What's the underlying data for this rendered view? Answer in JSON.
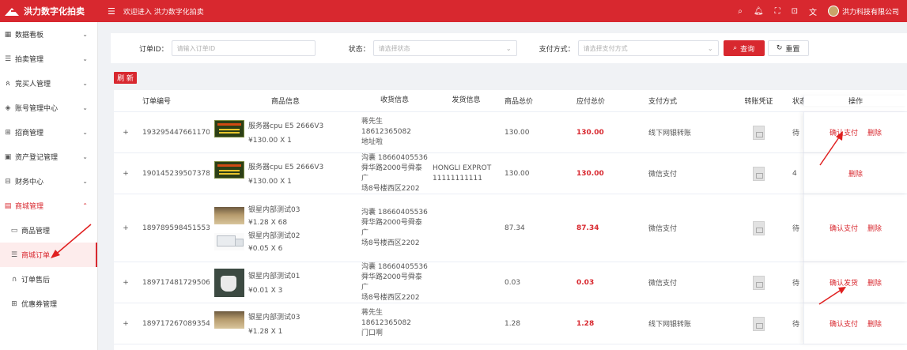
{
  "app": {
    "title": "洪力数字化拍卖",
    "welcome": "欢迎进入 洪力数字化拍卖",
    "company": "洪力科技有限公司",
    "brand_color": "#d8282f",
    "top_icons": [
      "search-icon",
      "bell-icon",
      "fullscreen-icon",
      "lock-icon",
      "translate-icon"
    ]
  },
  "sidebar": {
    "items": [
      {
        "label": "数据看板",
        "icon": "grid-icon"
      },
      {
        "label": "拍卖管理",
        "icon": "list-icon"
      },
      {
        "label": "竞买人管理",
        "icon": "people-icon"
      },
      {
        "label": "账号管理中心",
        "icon": "account-icon"
      },
      {
        "label": "招商管理",
        "icon": "plus-square-icon"
      },
      {
        "label": "资产登记管理",
        "icon": "register-icon"
      },
      {
        "label": "财务中心",
        "icon": "finance-icon"
      },
      {
        "label": "商城管理",
        "icon": "store-icon"
      },
      {
        "label": "商品管理",
        "icon": "goods-icon"
      },
      {
        "label": "商城订单",
        "icon": "order-list-icon"
      },
      {
        "label": "订单售后",
        "icon": "headset-icon"
      },
      {
        "label": "优惠券管理",
        "icon": "gift-icon"
      }
    ]
  },
  "filter": {
    "order_id_label": "订单ID：",
    "order_id_placeholder": "请输入订单ID",
    "status_label": "状态：",
    "status_placeholder": "请选择状态",
    "pay_label": "支付方式：",
    "pay_placeholder": "请选择支付方式",
    "search_label": "查询",
    "reset_label": "重置"
  },
  "refresh_label": "刷 新",
  "table": {
    "headers": [
      "订单编号",
      "商品信息",
      "收货信息",
      "发货信息",
      "商品总价",
      "应付总价",
      "支付方式",
      "转账凭证",
      "状态",
      "操作"
    ],
    "rows": [
      {
        "expand": "+",
        "order_no": "193295447661170...",
        "goods": [
          {
            "name": "服务器cpu E5 2666V3",
            "qty": "¥130.00 X 1",
            "thumb": "cpu"
          }
        ],
        "receiver": [
          "蒋先生",
          "18612365082",
          "地址啦"
        ],
        "shipping": [],
        "goods_total": "130.00",
        "payable": "130.00",
        "pay_method": "线下网银转账",
        "status": "待",
        "actions": [
          "确认支付",
          "删除"
        ]
      },
      {
        "expand": "+",
        "order_no": "190145239507378...",
        "goods": [
          {
            "name": "服务器cpu E5 2666V3",
            "qty": "¥130.00 X 1",
            "thumb": "cpu"
          }
        ],
        "receiver": [
          "沟囊 18660405536",
          "舜华路2000号舜泰广",
          "场8号楼西区2202"
        ],
        "shipping": [
          "HONGLI EXPROT",
          "11111111111"
        ],
        "goods_total": "130.00",
        "payable": "130.00",
        "pay_method": "微信支付",
        "status": "4",
        "actions": [
          "删除"
        ]
      },
      {
        "expand": "+",
        "order_no": "189789598451553...",
        "goods": [
          {
            "name": "银星内部测试03",
            "qty": "¥1.28 X 68",
            "thumb": "bar"
          },
          {
            "name": "银星内部测试02",
            "qty": "¥0.05 X 6",
            "thumb": "truck"
          }
        ],
        "receiver": [
          "沟囊 18660405536",
          "舜华路2000号舜泰广",
          "场8号楼西区2202"
        ],
        "shipping": [],
        "goods_total": "87.34",
        "payable": "87.34",
        "pay_method": "微信支付",
        "status": "待",
        "actions": [
          "确认支付",
          "删除"
        ]
      },
      {
        "expand": "+",
        "order_no": "189717481729506...",
        "goods": [
          {
            "name": "银星内部测试01",
            "qty": "¥0.01 X 3",
            "thumb": "cup"
          }
        ],
        "receiver": [
          "沟囊 18660405536",
          "舜华路2000号舜泰广",
          "场8号楼西区2202"
        ],
        "shipping": [],
        "goods_total": "0.03",
        "payable": "0.03",
        "pay_method": "微信支付",
        "status": "待",
        "actions": [
          "确认发货",
          "删除"
        ]
      },
      {
        "expand": "+",
        "order_no": "189717267089354...",
        "goods": [
          {
            "name": "银星内部测试03",
            "qty": "¥1.28 X 1",
            "thumb": "bar"
          }
        ],
        "receiver": [
          "蒋先生",
          "18612365082",
          "门口啊"
        ],
        "shipping": [],
        "goods_total": "1.28",
        "payable": "1.28",
        "pay_method": "线下网银转账",
        "status": "待",
        "actions": [
          "确认支付",
          "删除"
        ]
      }
    ]
  }
}
